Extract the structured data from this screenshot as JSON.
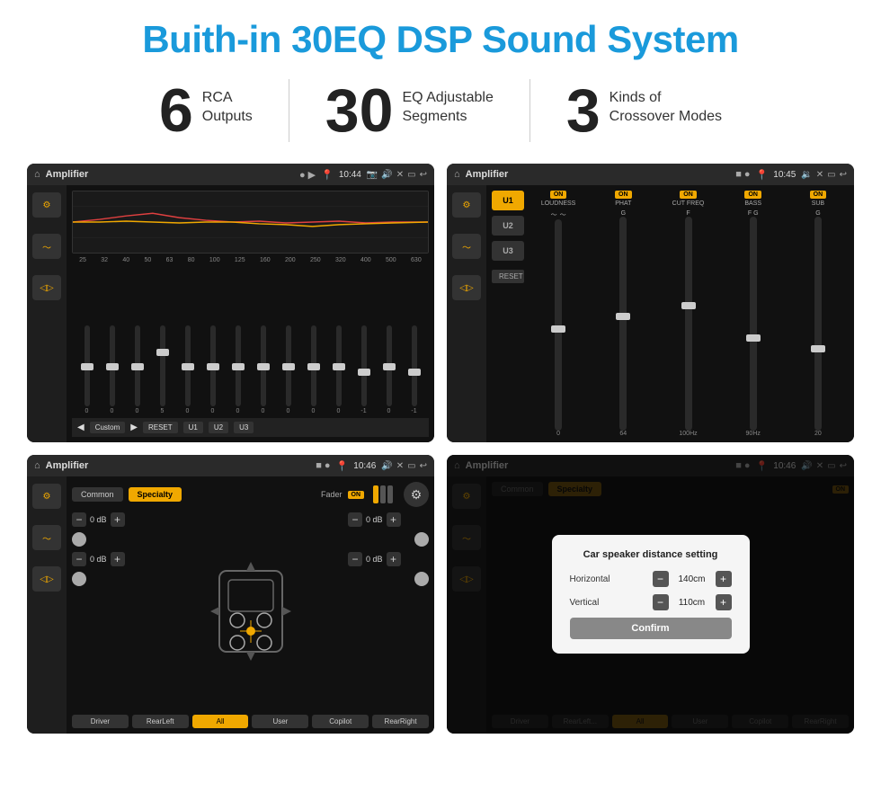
{
  "title": "Buith-in 30EQ DSP Sound System",
  "stats": [
    {
      "number": "6",
      "label": "RCA\nOutputs"
    },
    {
      "number": "30",
      "label": "EQ Adjustable\nSegments"
    },
    {
      "number": "3",
      "label": "Kinds of\nCrossover Modes"
    }
  ],
  "screens": [
    {
      "id": "eq-screen",
      "topbar": {
        "title": "Amplifier",
        "time": "10:44"
      },
      "type": "equalizer",
      "freqs": [
        "25",
        "32",
        "40",
        "50",
        "63",
        "80",
        "100",
        "125",
        "160",
        "200",
        "250",
        "320",
        "400",
        "500",
        "630"
      ],
      "values": [
        "0",
        "0",
        "0",
        "5",
        "0",
        "0",
        "0",
        "0",
        "0",
        "0",
        "0",
        "-1",
        "0",
        "-1"
      ],
      "preset": "Custom",
      "buttons": [
        "RESET",
        "U1",
        "U2",
        "U3"
      ]
    },
    {
      "id": "amp-screen",
      "topbar": {
        "title": "Amplifier",
        "time": "10:45"
      },
      "type": "amplifier",
      "presets": [
        "U1",
        "U2",
        "U3"
      ],
      "channels": [
        {
          "label": "LOUDNESS",
          "on": true
        },
        {
          "label": "PHAT",
          "on": true
        },
        {
          "label": "CUT FREQ",
          "on": true
        },
        {
          "label": "BASS",
          "on": true
        },
        {
          "label": "SUB",
          "on": true
        }
      ]
    },
    {
      "id": "mixer-screen",
      "topbar": {
        "title": "Amplifier",
        "time": "10:46"
      },
      "type": "mixer",
      "tabs": [
        "Common",
        "Specialty"
      ],
      "activeTab": "Specialty",
      "fader": {
        "label": "Fader",
        "on": true
      },
      "leftControls": [
        {
          "value": "0 dB"
        },
        {
          "value": "0 dB"
        }
      ],
      "rightControls": [
        {
          "value": "0 dB"
        },
        {
          "value": "0 dB"
        }
      ],
      "bottomButtons": [
        "Driver",
        "RearLeft",
        "All",
        "User",
        "Copilot",
        "RearRight"
      ]
    },
    {
      "id": "dialog-screen",
      "topbar": {
        "title": "Amplifier",
        "time": "10:46"
      },
      "type": "dialog",
      "tabs": [
        "Common",
        "Specialty"
      ],
      "activeTab": "Specialty",
      "fader": {
        "on": true
      },
      "dialog": {
        "title": "Car speaker distance setting",
        "horizontal": {
          "label": "Horizontal",
          "value": "140cm"
        },
        "vertical": {
          "label": "Vertical",
          "value": "110cm"
        },
        "confirmLabel": "Confirm"
      },
      "bottomButtons": [
        "Driver",
        "RearLeft",
        "All",
        "User",
        "Copilot",
        "RearRight"
      ]
    }
  ]
}
